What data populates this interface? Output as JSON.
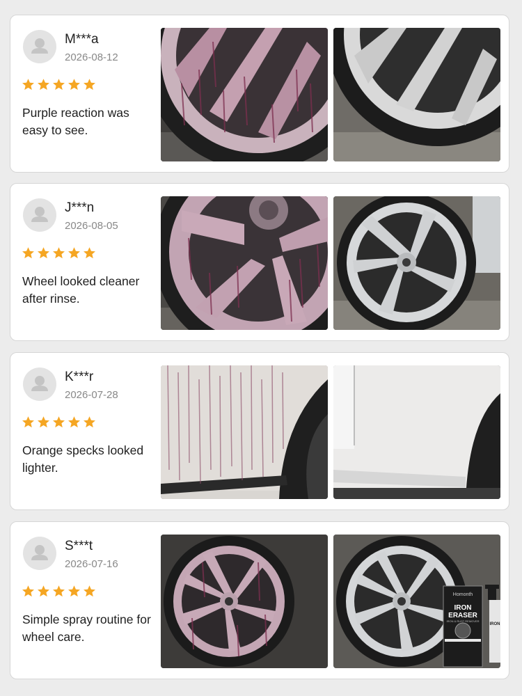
{
  "colors": {
    "star": "#f5a623",
    "avatar_bg": "#e3e3e3",
    "avatar_fg": "#c4c4c4",
    "iron_reaction": "#7d2f4f"
  },
  "reviews": [
    {
      "name": "M***a",
      "date": "2026-08-12",
      "rating": 5,
      "text": "Purple reaction was easy to see.",
      "photos": [
        "wheel-spokes-purple-before",
        "wheel-spokes-clean-after"
      ]
    },
    {
      "name": "J***n",
      "date": "2026-08-05",
      "rating": 5,
      "text": "Wheel looked cleaner after rinse.",
      "photos": [
        "wheel-purple-before",
        "wheel-clean-after"
      ]
    },
    {
      "name": "K***r",
      "date": "2026-07-28",
      "rating": 5,
      "text": "Orange specks looked lighter.",
      "photos": [
        "car-panel-purple-streaks-before",
        "car-panel-clean-after"
      ]
    },
    {
      "name": "S***t",
      "date": "2026-07-16",
      "rating": 5,
      "text": "Simple spray routine for wheel care.",
      "photos": [
        "wheel-purple-before",
        "wheel-clean-with-product-after"
      ]
    }
  ],
  "product": {
    "brand": "Homonth",
    "name_line1": "IRON",
    "name_line2": "ERASER",
    "tagline": "IRON & RUST REMOVER"
  }
}
